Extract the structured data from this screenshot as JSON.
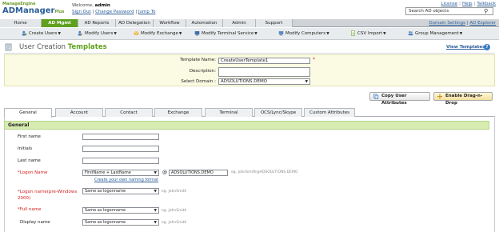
{
  "header": {
    "logo_top": "ManageEngine",
    "logo_main": "ADManager",
    "logo_plus": "Plus",
    "welcome_prefix": "Welcome,",
    "user": "admin",
    "sign_out": "Sign Out",
    "change_password": "Change Password",
    "jump_to": "Jump To",
    "links": [
      "License",
      "Help",
      "Talkback"
    ],
    "search_placeholder": "Search AD objects",
    "domain_settings": "Domain Settings",
    "ad_explorer": "AD Explorer"
  },
  "main_tabs": [
    "Home",
    "AD Mgmt",
    "AD Reports",
    "AD Delegation",
    "Workflow",
    "Automation",
    "Admin",
    "Support"
  ],
  "sub_menu": [
    "Create Users",
    "Modify Users",
    "Modify Exchange",
    "Modify Terminal Service",
    "Modify Computers",
    "CSV Import",
    "Group Management"
  ],
  "page": {
    "title_prefix": "User Creation",
    "title_highlight": "Templates",
    "view_templates": "View Templates",
    "help": "?"
  },
  "template_form": {
    "name_label": "Template Name:",
    "name_value": "CreateUserTemplate1",
    "description_label": "Description:",
    "domain_label": "Select Domain :",
    "domain_value": "ADSOLUTIONS.DEMO"
  },
  "actions": {
    "copy_attributes": "Copy User Attributes",
    "drag_drop": "Enable Drag-n-Drop"
  },
  "form_tabs": [
    "General",
    "Account",
    "Contact",
    "Exchange",
    "Terminal",
    "OCS/Lync/Skype",
    "Custom Attributes"
  ],
  "general": {
    "heading": "General",
    "first_name": "First name",
    "initials": "Initials",
    "last_name": "Last name",
    "logon_name": "Logon Name",
    "logon_format": "FirstName + LastName",
    "at": "@",
    "logon_domain": "ADSOLUTIONS.DEMO",
    "logon_example": "eg. JohnSmith@ADSOLUTIONS.DEMO",
    "naming_format_link": "Create your own naming format",
    "pre2000_label": "Logon name(pre-Windows 2000)",
    "pre2000_value": "Same as logonname",
    "pre2000_example": "eg. JohnSmith",
    "full_name": "Full name",
    "full_name_value": "Same as logonname",
    "full_name_example": "eg. JohnSmith",
    "display_name": "Display name",
    "display_name_value": "Same as logonname",
    "display_name_example": "eg. JohnSmith"
  },
  "colors": {
    "accent_green": "#5fa11e",
    "link_blue": "#2a5d9a",
    "required_red": "#d42020",
    "section_header": "#d7ecb1"
  }
}
